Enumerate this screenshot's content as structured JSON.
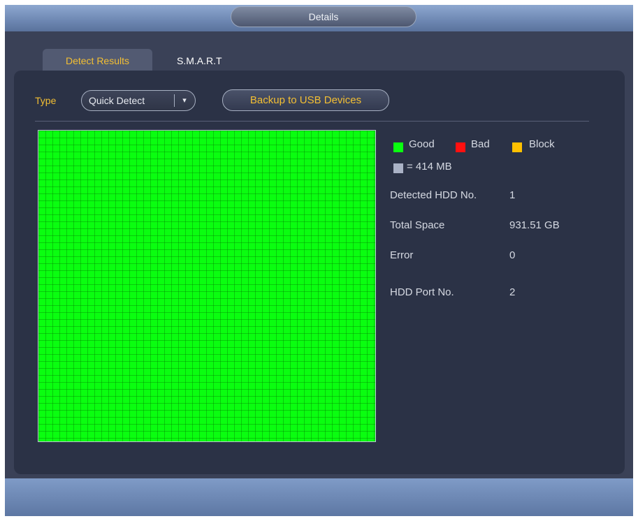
{
  "window": {
    "title": "Details"
  },
  "tabs": [
    {
      "label": "Detect Results",
      "active": true
    },
    {
      "label": "S.M.A.R.T",
      "active": false
    }
  ],
  "toolbar": {
    "type_label": "Type",
    "type_value": "Quick Detect",
    "backup_button": "Backup to USB Devices"
  },
  "legend": {
    "good": {
      "label": "Good",
      "color": "#0afe10"
    },
    "bad": {
      "label": "Bad",
      "color": "#ff1010"
    },
    "block": {
      "label": "Block",
      "color": "#ffc000"
    },
    "unit": {
      "label": "= 414 MB",
      "color": "#aab2c6"
    }
  },
  "info": [
    {
      "label": "Detected HDD No.",
      "value": "1"
    },
    {
      "label": "Total Space",
      "value": "931.51 GB"
    },
    {
      "label": "Error",
      "value": "0"
    },
    {
      "label": "HDD Port No.",
      "value": "2"
    }
  ],
  "colors": {
    "accent": "#f3bf33",
    "panel": "#2b3246",
    "window": "#3a4157",
    "title": "#6d87b2"
  }
}
